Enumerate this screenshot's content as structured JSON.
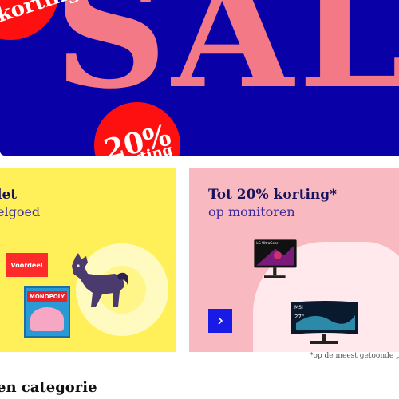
{
  "hero": {
    "sale_text": "SALE",
    "badge_top_text": "korting*",
    "badge_bottom_percent": "20%",
    "badge_bottom_word": "korting",
    "colors": {
      "background": "#0a00a8",
      "sale_text": "#f47986",
      "badge": "#ff1010"
    }
  },
  "promo_left": {
    "title": "let",
    "subtitle": "elgoed",
    "badge_label": "Voordeel",
    "product_box_label": "MONOPOLY",
    "colors": {
      "background": "#fff05a",
      "badge": "#ff2b2b"
    }
  },
  "promo_right": {
    "title": "Tot 20% korting*",
    "subtitle": "op monitoren",
    "monitor_top_brand": "LG UltraGear",
    "monitor_bottom_brand": "MSI",
    "monitor_bottom_text": "27\"",
    "next_icon": "chevron-right-icon",
    "colors": {
      "background": "#f8b9c0",
      "button": "#1a1ae6"
    }
  },
  "footnote": "*op de meest getoonde pr",
  "section_heading": "en categorie"
}
